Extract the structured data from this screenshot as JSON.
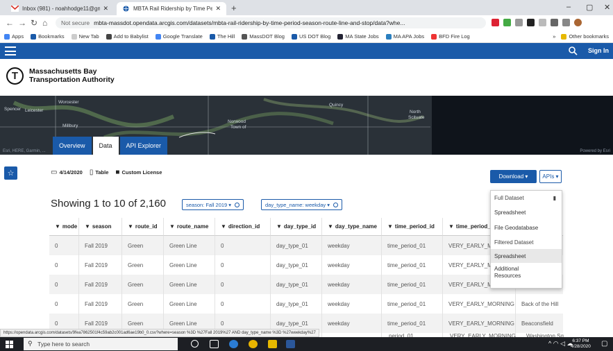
{
  "browser": {
    "tabs": [
      {
        "title": "Inbox (981) - noahhodge11@gm",
        "active": false
      },
      {
        "title": "MBTA Rail Ridership by Time Per",
        "active": true
      }
    ],
    "address": {
      "security": "Not secure",
      "url": "mbta-massdot.opendata.arcgis.com/datasets/mbta-rail-ridership-by-time-period-season-route-line-and-stop/data?whe..."
    },
    "bookmarks": [
      "Apps",
      "Bookmarks",
      "New Tab",
      "Add to Babylist",
      "Google Translate",
      "The Hill",
      "MassDOT Blog",
      "US DOT Blog",
      "MA State Jobs",
      "MA APA Jobs",
      "BFD Fire Log"
    ],
    "bookmarks_more": "»",
    "other_bookmarks": "Other bookmarks",
    "window_controls": {
      "minimize": "–",
      "maximize": "▢",
      "close": "✕"
    }
  },
  "site": {
    "sign_in": "Sign In",
    "org_line1": "Massachusetts Bay",
    "org_line2": "Transportation Authority",
    "logo_letter": "T"
  },
  "map": {
    "labels": [
      "Spencer",
      "Leicester",
      "Worcester",
      "Millbury",
      "Norwood",
      "Town of",
      "Quincy",
      "North",
      "Scituate"
    ],
    "credit_left": "Esri, HERE, Garmin, ...",
    "credit_right": "Powered by Esri"
  },
  "page_tabs": [
    {
      "label": "Overview",
      "current": false
    },
    {
      "label": "Data",
      "current": true
    },
    {
      "label": "API Explorer",
      "current": false
    }
  ],
  "meta": {
    "date": "4/14/2020",
    "type": "Table",
    "license": "Custom License"
  },
  "actions": {
    "download": "Download ▾",
    "apis": "APIs ▾"
  },
  "showing_text": "Showing 1 to 10 of 2,160",
  "filters": [
    "season: Fall 2019 ▾",
    "day_type_name: weekday ▾"
  ],
  "table": {
    "columns": [
      "mode",
      "season",
      "route_id",
      "route_name",
      "direction_id",
      "day_type_id",
      "day_type_name",
      "time_period_id",
      "time_period_",
      "stop_name"
    ],
    "rows": [
      [
        "0",
        "Fall 2019",
        "Green",
        "Green Line",
        "0",
        "day_type_01",
        "weekday",
        "time_period_01",
        "VERY_EARLY_M",
        ""
      ],
      [
        "0",
        "Fall 2019",
        "Green",
        "Green Line",
        "0",
        "day_type_01",
        "weekday",
        "time_period_01",
        "VERY_EARLY_M",
        ""
      ],
      [
        "0",
        "Fall 2019",
        "Green",
        "Green Line",
        "0",
        "day_type_01",
        "weekday",
        "time_period_01",
        "VERY_EARLY_M",
        "et"
      ],
      [
        "0",
        "Fall 2019",
        "Green",
        "Green Line",
        "0",
        "day_type_01",
        "weekday",
        "time_period_01",
        "VERY_EARLY_MORNING",
        "Back of the Hill"
      ],
      [
        "0",
        "Fall 2019",
        "Green",
        "Green Line",
        "0",
        "day_type_01",
        "weekday",
        "time_period_01",
        "VERY_EARLY_MORNING",
        "Beaconsfield"
      ]
    ],
    "partial_row": [
      "",
      "",
      "",
      "",
      "",
      "",
      "",
      "period_01",
      "VERY_EARLY_MORNING",
      "Washington Sq"
    ]
  },
  "download_menu": [
    {
      "label": "Full Dataset",
      "kind": "header"
    },
    {
      "label": "Spreadsheet",
      "kind": "item"
    },
    {
      "label": "File Geodatabase",
      "kind": "item"
    },
    {
      "label": "Filtered Dataset",
      "kind": "header"
    },
    {
      "label": "Spreadsheet",
      "kind": "selected"
    },
    {
      "label": "Additional Resources",
      "kind": "item"
    }
  ],
  "status_url": "https://opendata.arcgis.com/datasets/9fea7862501f4c59ab2c001ad6ae19b0_0.csv?where=season %3D %27Fall 2019%27 AND day_type_name %3D %27weekday%27",
  "taskbar": {
    "search_placeholder": "Type here to search",
    "time": "6:37 PM",
    "date": "4/28/2020"
  },
  "colors": {
    "brand": "#1a5aa9",
    "taskbar": "#1d1f24"
  }
}
